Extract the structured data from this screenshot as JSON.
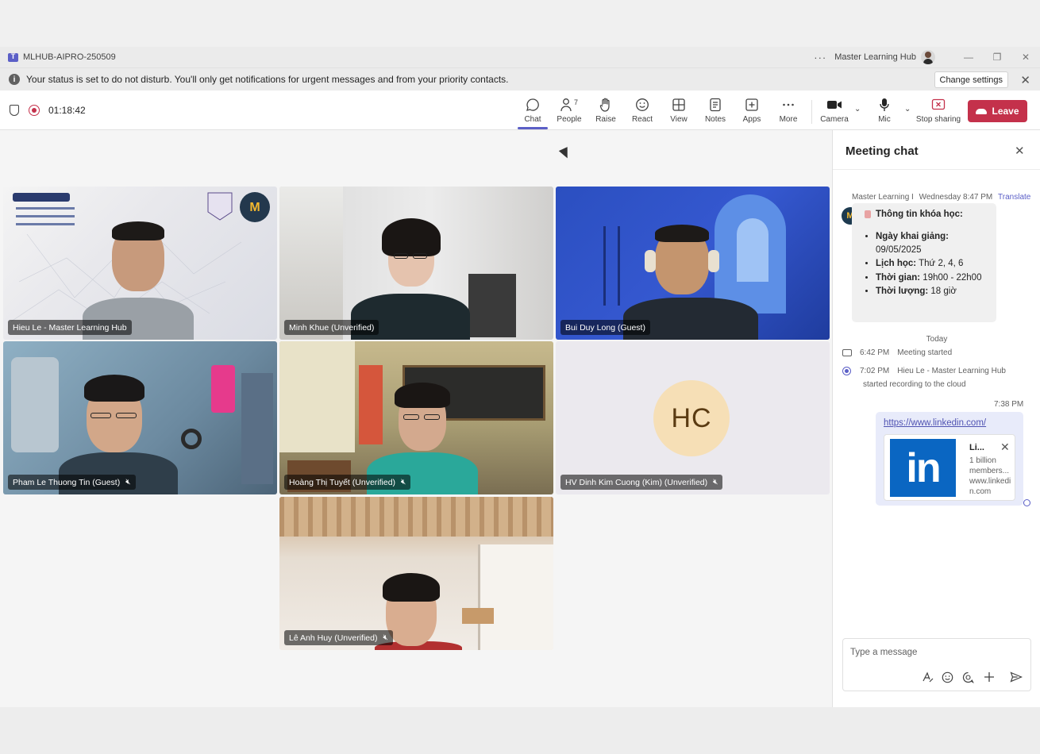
{
  "window": {
    "title": "MLHUB-AIPRO-250509",
    "account_name": "Master Learning Hub",
    "more_label": "···"
  },
  "banner": {
    "message": "Your status is set to do not disturb. You'll only get notifications for urgent messages and from your priority contacts.",
    "change_settings_label": "Change settings"
  },
  "meeting": {
    "timer": "01:18:42"
  },
  "toolbar": {
    "chat_label": "Chat",
    "people_label": "People",
    "people_count": "7",
    "raise_label": "Raise",
    "react_label": "React",
    "view_label": "View",
    "notes_label": "Notes",
    "apps_label": "Apps",
    "more_label": "More",
    "camera_label": "Camera",
    "mic_label": "Mic",
    "stop_sharing_label": "Stop sharing",
    "leave_label": "Leave"
  },
  "participants": [
    {
      "name": "Hieu Le - Master Learning Hub",
      "muted": false
    },
    {
      "name": "Minh Khue (Unverified)",
      "muted": false
    },
    {
      "name": "Bui Duy Long (Guest)",
      "muted": false
    },
    {
      "name": "Pham Le Thuong Tin (Guest)",
      "muted": true
    },
    {
      "name": "Hoàng Thị Tuyết (Unverified)",
      "muted": true
    },
    {
      "name": "HV Dinh Kim Cuong (Kim) (Unverified)",
      "muted": true,
      "initials": "HC"
    },
    {
      "name": "Lê Anh Huy (Unverified)",
      "muted": true
    }
  ],
  "chat": {
    "title": "Meeting chat",
    "message1": {
      "sender": "Master Learning I",
      "time": "Wednesday 8:47 PM",
      "translate_label": "Translate",
      "avatar_text": "M",
      "heading": "Thông tin khóa học:",
      "items": [
        {
          "label": "Ngày khai giảng:",
          "value": "09/05/2025"
        },
        {
          "label": "Lịch học:",
          "value": "Thứ 2, 4, 6"
        },
        {
          "label": "Thời gian:",
          "value": "19h00 - 22h00"
        },
        {
          "label": "Thời lượng:",
          "value": "18 giờ"
        }
      ]
    },
    "divider": "Today",
    "events": [
      {
        "time": "6:42 PM",
        "text": "Meeting started"
      },
      {
        "time": "7:02 PM",
        "text": "Hieu Le - Master Learning Hub",
        "text2": "started recording to the cloud"
      }
    ],
    "sent": {
      "time": "7:38 PM",
      "link": "https://www.linkedin.com/",
      "card_title": "Li...",
      "card_desc": "1 billion members...",
      "card_domain": "www.linkedin.com",
      "logo_text": "in"
    },
    "compose_placeholder": "Type a message"
  },
  "colors": {
    "accent": "#5b5fc7",
    "leave": "#c4314b",
    "linkedin": "#0a66c2"
  }
}
